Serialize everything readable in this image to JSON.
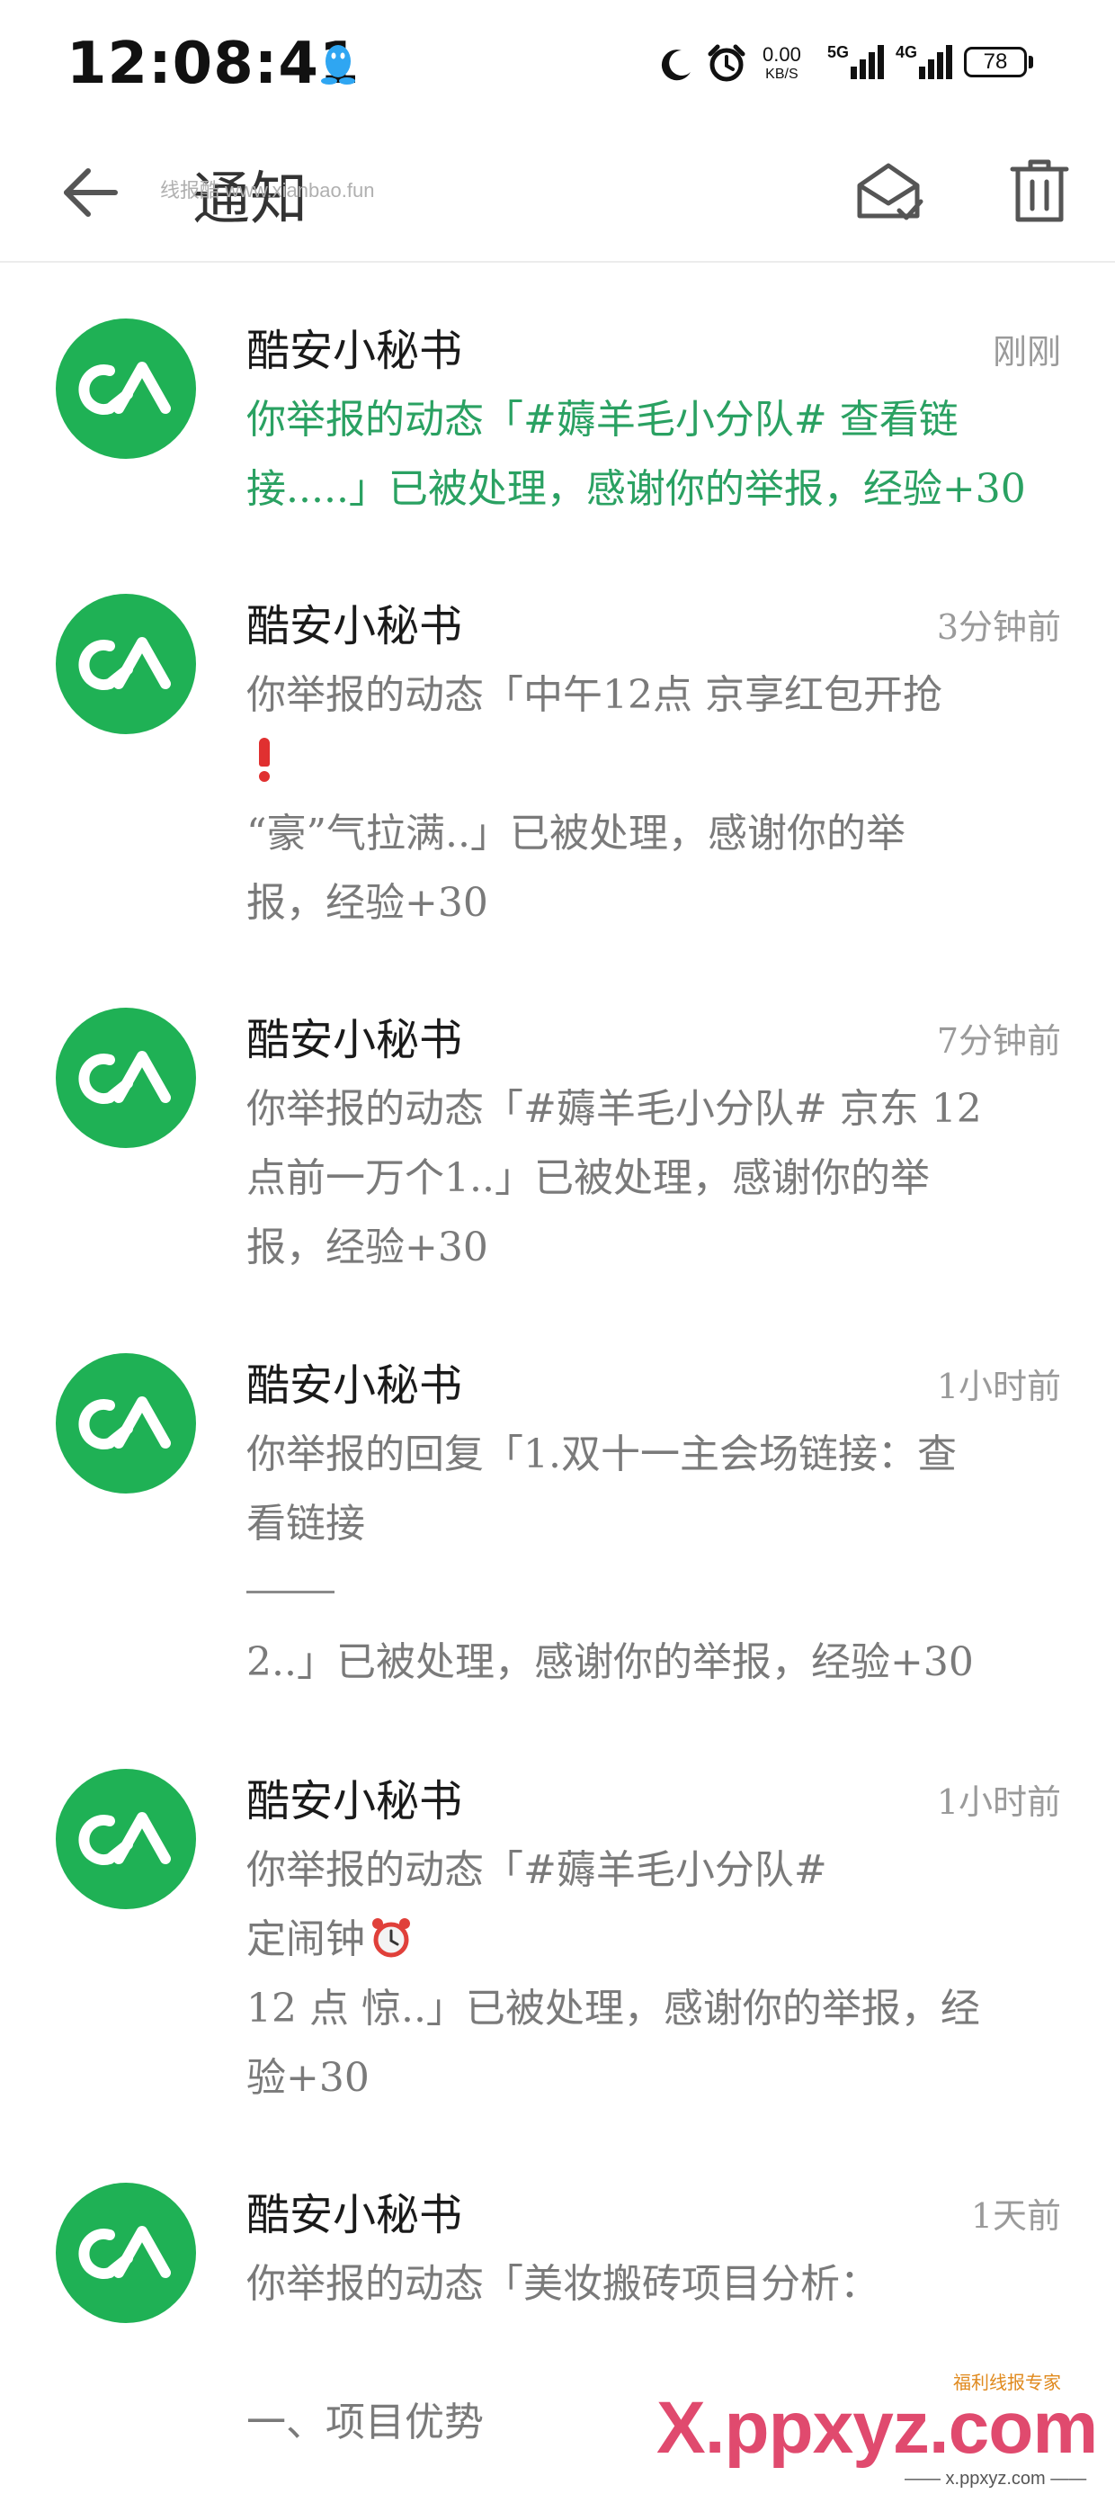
{
  "status_bar": {
    "time": "12:08:41",
    "net_speed_value": "0.00",
    "net_speed_unit": "KB/S",
    "signal_5g_label": "5G",
    "signal_4g_label": "4G",
    "battery_level": "78"
  },
  "app_bar": {
    "title": "通知",
    "watermark": "线报酷 www.xianbao.fun"
  },
  "notifications": [
    {
      "sender": "酷安小秘书",
      "time": "刚刚",
      "unread": true,
      "lines": [
        "你举报的动态「#薅羊毛小分队# 查看链",
        "接.....」已被处理，感谢你的举报，经验+30"
      ]
    },
    {
      "sender": "酷安小秘书",
      "time": "3分钟前",
      "unread": false,
      "lines": [
        "你举报的动态「中午12点 京享红包开抢",
        "“豪”气拉满..」已被处理，感谢你的举",
        "报，经验+30"
      ]
    },
    {
      "sender": "酷安小秘书",
      "time": "7分钟前",
      "unread": false,
      "lines": [
        "你举报的动态「#薅羊毛小分队# 京东 12",
        "点前一万个1..」已被处理，感谢你的举",
        "报，经验+30"
      ]
    },
    {
      "sender": "酷安小秘书",
      "time": "1小时前",
      "unread": false,
      "lines": [
        "你举报的回复「1.双十一主会场链接：查",
        "看链接",
        "2..」已被处理，感谢你的举报，经验+30"
      ]
    },
    {
      "sender": "酷安小秘书",
      "time": "1小时前",
      "unread": false,
      "lines": [
        "你举报的动态「#薅羊毛小分队#",
        "定闹钟",
        "12 点 惊..」已被处理，感谢你的举报，经",
        "验+30"
      ]
    },
    {
      "sender": "酷安小秘书",
      "time": "1天前",
      "unread": false,
      "lines": [
        "你举报的动态「美妆搬砖项目分析：",
        "一、项目优势"
      ]
    }
  ],
  "brand": {
    "text": "X.ppxyz.com",
    "tag": "福利线报专家",
    "sub": "—— x.ppxyz.com ——"
  },
  "colors": {
    "accent_green": "#2aa162",
    "avatar_green": "#1fb155"
  }
}
